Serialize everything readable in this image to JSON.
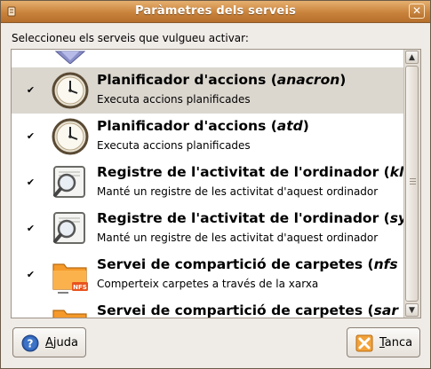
{
  "window": {
    "title": "Paràmetres dels serveis",
    "close_glyph": "✕"
  },
  "prompt": "Seleccioneu els serveis que vulgueu activar:",
  "services": [
    {
      "name_prefix": "",
      "name_italic": "",
      "description": "",
      "checked": false,
      "icon": "partial-blue-icon"
    },
    {
      "name_prefix": "Planificador d'accions (",
      "name_italic": "anacron",
      "name_suffix": ")",
      "description": "Executa accions planificades",
      "checked": true,
      "icon": "clock-icon"
    },
    {
      "name_prefix": "Planificador d'accions (",
      "name_italic": "atd",
      "name_suffix": ")",
      "description": "Executa accions planificades",
      "checked": true,
      "icon": "clock-icon"
    },
    {
      "name_prefix": "Registre de l'activitat de l'ordinador (",
      "name_italic": "kl",
      "name_suffix": "",
      "description": "Manté un registre de les activitat d'aquest ordinador",
      "checked": true,
      "icon": "log-magnifier-icon"
    },
    {
      "name_prefix": "Registre de l'activitat de l'ordinador (",
      "name_italic": "sy",
      "name_suffix": "",
      "description": "Manté un registre de les activitat d'aquest ordinador",
      "checked": true,
      "icon": "log-magnifier-icon"
    },
    {
      "name_prefix": "Servei de compartició de carpetes (",
      "name_italic": "nfs",
      "name_suffix": "",
      "description": "Comperteix carpetes a través de la xarxa",
      "checked": true,
      "icon": "nfs-folder-icon"
    },
    {
      "name_prefix": "Servei de compartició de carpetes (",
      "name_italic": "sar",
      "name_suffix": "",
      "description": "",
      "checked": false,
      "icon": "folder-icon"
    }
  ],
  "check_glyph": "✔",
  "scroll": {
    "up_glyph": "▲",
    "down_glyph": "▼"
  },
  "buttons": {
    "help": {
      "mnemonic": "A",
      "rest": "juda"
    },
    "close": {
      "mnemonic": "T",
      "rest": "anca"
    }
  },
  "colors": {
    "titlebar": "#c9833c",
    "selected_row": "#dbd7cf",
    "folder": "#f59a2a",
    "nfs_badge": "#e8531d"
  }
}
